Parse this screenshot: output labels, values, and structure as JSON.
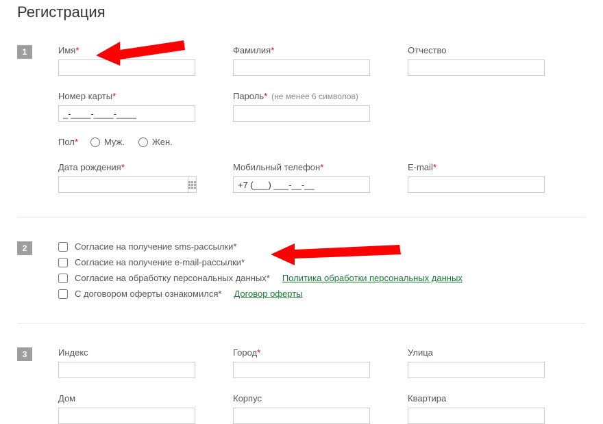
{
  "title": "Регистрация",
  "sections": {
    "s1": {
      "step": "1",
      "firstName": "Имя",
      "lastName": "Фамилия",
      "middleName": "Отчество",
      "cardNumber": "Номер карты",
      "cardValue": "_-____-____-____",
      "password": "Пароль",
      "passwordHint": "(не менее 6 символов)",
      "gender": "Пол",
      "male": "Муж.",
      "female": "Жен.",
      "birthDate": "Дата рождения",
      "mobile": "Мобильный телефон",
      "mobileValue": "+7 (___) ___-__-__",
      "email": "E-mail"
    },
    "s2": {
      "step": "2",
      "sms": "Согласие на получение sms-рассылки",
      "emailNews": "Согласие на получение e-mail-рассылки",
      "personal": "Согласие на обработку персональных данных",
      "personalLink": "Политика обработки персональных данных",
      "offer": "С договором оферты ознакомился",
      "offerLink": "Договор оферты"
    },
    "s3": {
      "step": "3",
      "index": "Индекс",
      "city": "Город",
      "street": "Улица",
      "house": "Дом",
      "building": "Корпус",
      "apartment": "Квартира"
    }
  }
}
